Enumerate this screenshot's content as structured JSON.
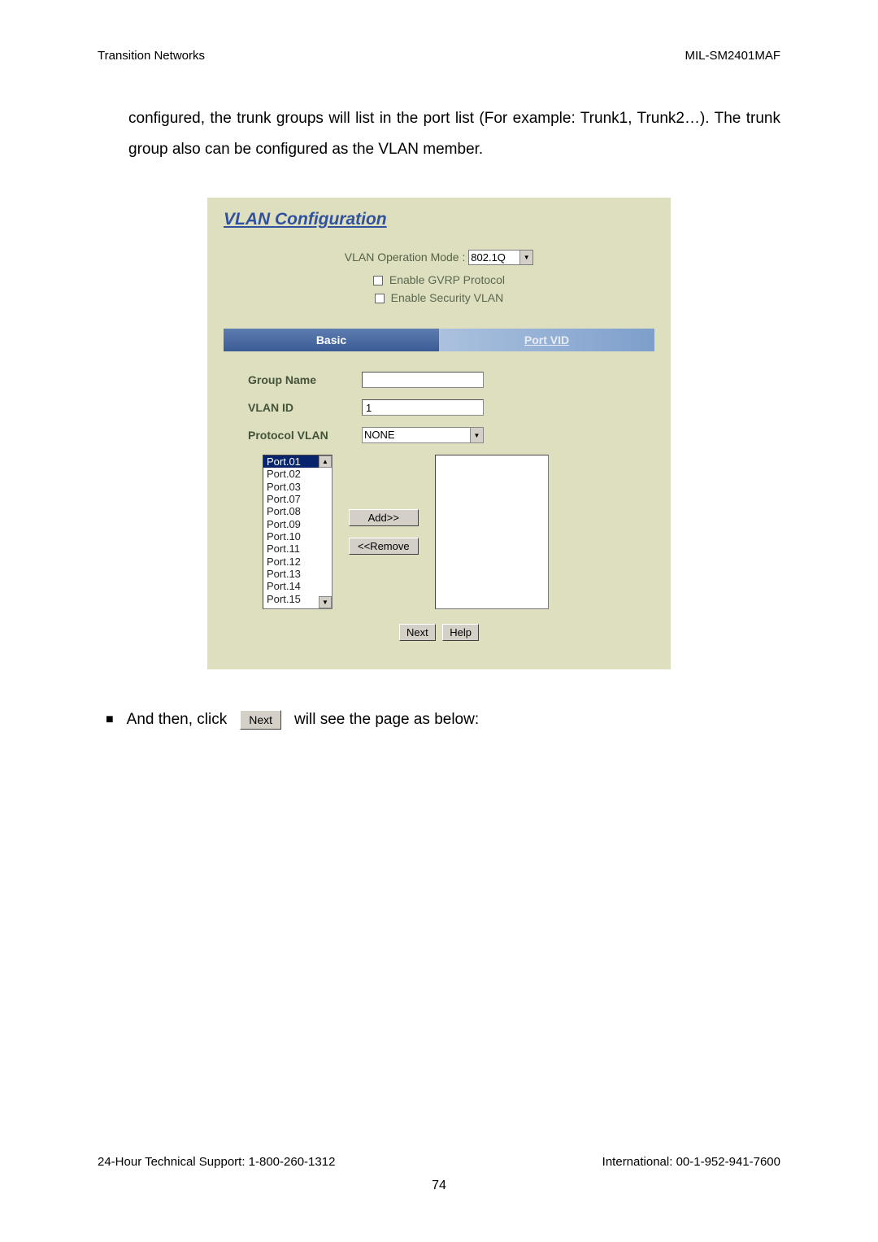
{
  "header": {
    "left": "Transition Networks",
    "right": "MIL-SM2401MAF"
  },
  "body_text": "configured, the trunk groups will list in the port list (For example: Trunk1, Trunk2…). The trunk group also can be configured as the VLAN member.",
  "panel": {
    "title": "VLAN Configuration",
    "mode_label": "VLAN Operation Mode :",
    "mode_value": "802.1Q",
    "checkbox_gvrp": "Enable GVRP Protocol",
    "checkbox_security": "Enable Security VLAN",
    "tabs": {
      "basic": "Basic",
      "port_vid": "Port VID"
    },
    "form": {
      "group_name_label": "Group Name",
      "group_name_value": "",
      "vlan_id_label": "VLAN ID",
      "vlan_id_value": "1",
      "protocol_label": "Protocol VLAN",
      "protocol_value": "NONE",
      "port_list": [
        "Port.01",
        "Port.02",
        "Port.03",
        "Port.07",
        "Port.08",
        "Port.09",
        "Port.10",
        "Port.11",
        "Port.12",
        "Port.13",
        "Port.14",
        "Port.15"
      ],
      "add_btn": "Add>>",
      "remove_btn": "<<Remove"
    },
    "buttons": {
      "next": "Next",
      "help": "Help"
    }
  },
  "bullet_text_before": "And then, click",
  "bullet_btn": "Next",
  "bullet_text_after": "will see the page as below:",
  "footer": {
    "left": "24-Hour Technical Support: 1-800-260-1312",
    "right": "International: 00-1-952-941-7600",
    "page": "74"
  }
}
